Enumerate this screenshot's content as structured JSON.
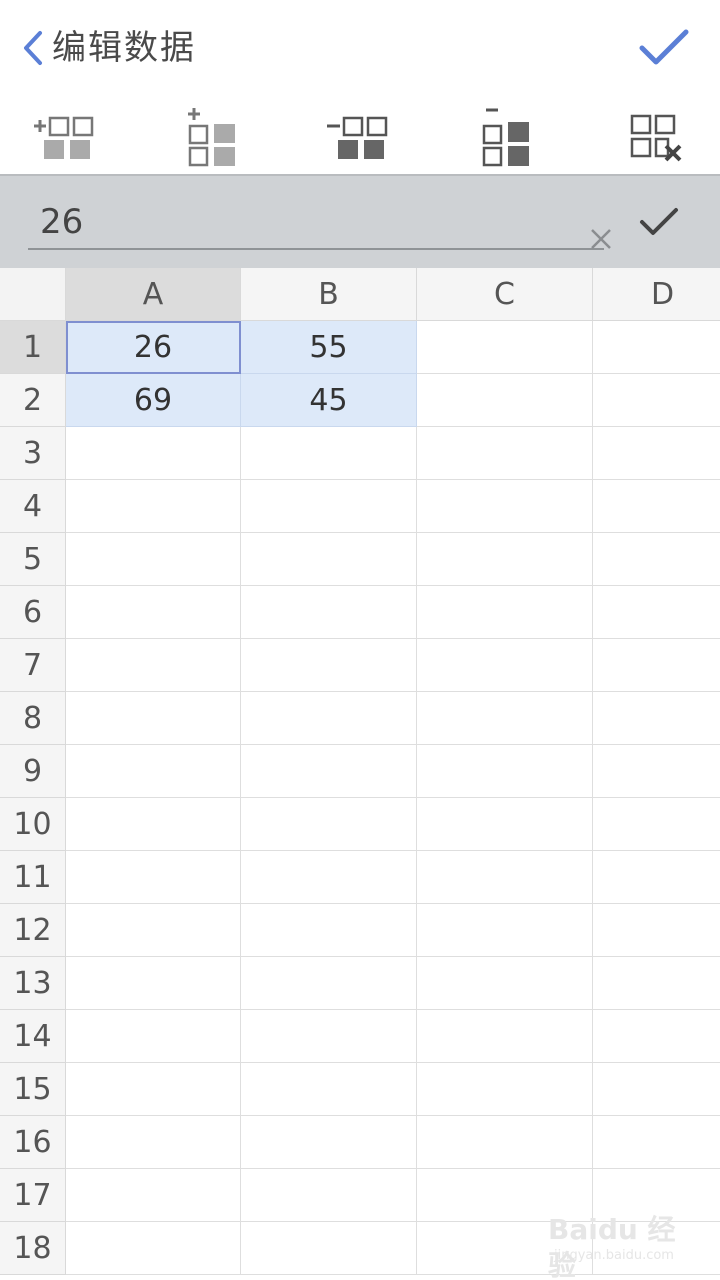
{
  "header": {
    "back_icon": "chevron-left-icon",
    "title": "编辑数据",
    "confirm_icon": "check-icon",
    "accent_color": "#5b7fd6"
  },
  "toolbar": {
    "tools": [
      {
        "name": "insert-column",
        "icon": "insert-column-icon"
      },
      {
        "name": "insert-row",
        "icon": "insert-row-icon"
      },
      {
        "name": "delete-column",
        "icon": "delete-column-icon"
      },
      {
        "name": "delete-row",
        "icon": "delete-row-icon"
      },
      {
        "name": "clear-table",
        "icon": "clear-table-icon"
      }
    ]
  },
  "editor": {
    "value": "26",
    "clear_icon": "close-icon",
    "commit_icon": "check-icon"
  },
  "sheet": {
    "columns": [
      "A",
      "B",
      "C",
      "D"
    ],
    "rows": [
      "1",
      "2",
      "3",
      "4",
      "5",
      "6",
      "7",
      "8",
      "9",
      "10",
      "11",
      "12",
      "13",
      "14",
      "15",
      "16",
      "17",
      "18"
    ],
    "cells": [
      [
        "26",
        "55",
        "",
        ""
      ],
      [
        "69",
        "45",
        "",
        ""
      ]
    ],
    "selected_cell": "A1",
    "highlight_color": "#dde9f9"
  },
  "watermark": {
    "main": "Baidu 经验",
    "sub": "jingyan.baidu.com"
  }
}
